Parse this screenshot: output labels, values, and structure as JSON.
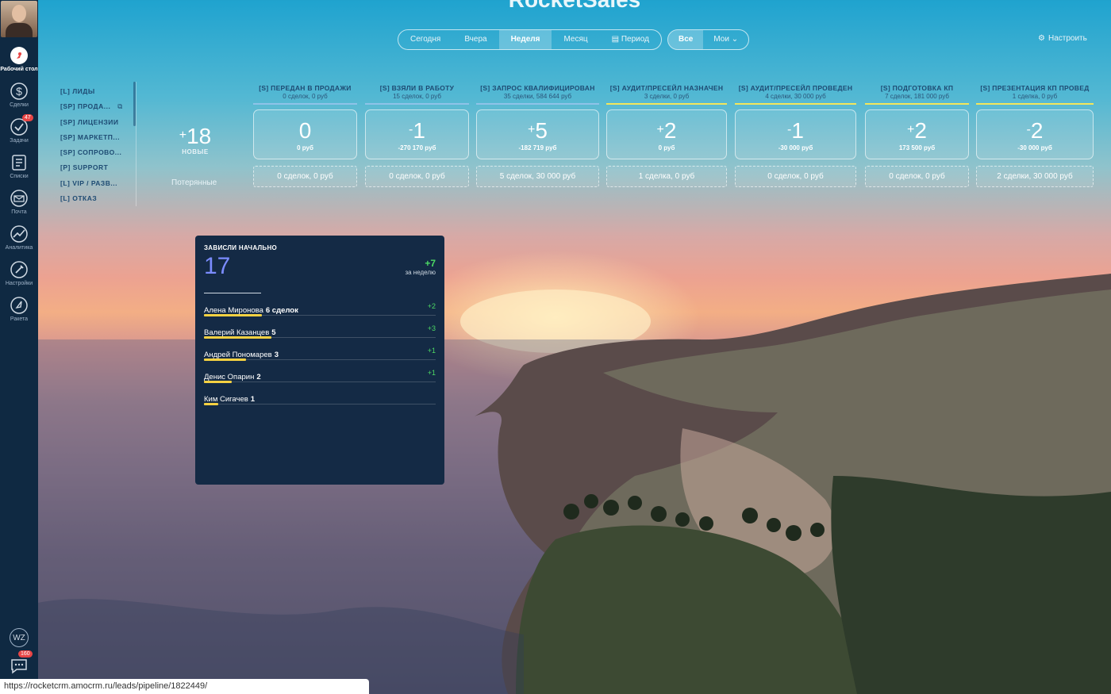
{
  "app": {
    "brand": "RocketSales"
  },
  "sidebar": {
    "items": [
      {
        "label": "Рабочий стол",
        "icon": "rocket-logo-icon",
        "active": true
      },
      {
        "label": "Сделки",
        "icon": "dollar-icon"
      },
      {
        "label": "Задачи",
        "icon": "checkmark-icon",
        "badge": "47"
      },
      {
        "label": "Списки",
        "icon": "list-icon"
      },
      {
        "label": "Почта",
        "icon": "mail-icon"
      },
      {
        "label": "Аналитика",
        "icon": "analytics-icon"
      },
      {
        "label": "Настройки",
        "icon": "settings-icon"
      },
      {
        "label": "Ракета",
        "icon": "rocket-icon"
      }
    ],
    "bottom": {
      "wz_label": "WZ",
      "chat_badge": "160"
    }
  },
  "filters": {
    "period": [
      "Сегодня",
      "Вчера",
      "Неделя",
      "Месяц",
      "Период"
    ],
    "period_active": "Неделя",
    "scope": [
      "Все",
      "Мои"
    ],
    "scope_active": "Все",
    "settings_label": "Настроить"
  },
  "pipelines": [
    "[L] ЛИДЫ",
    "[SP] ПРОДА...",
    "[SP] ЛИЦЕНЗИИ",
    "[SP] МАРКЕТП...",
    "[SP] СОПРОВО...",
    "[P] SUPPORT",
    "[L] VIP / РАЗВ...",
    "[L] ОТКАЗ"
  ],
  "summary": {
    "new_sign": "+",
    "new_count": "18",
    "new_label": "НОВЫЕ",
    "lost_label": "Потерянные"
  },
  "stages": [
    {
      "title": "[S] ПЕРЕДАН В ПРОДАЖИ",
      "sub": "0 сделок, 0 руб",
      "bar": "#8fc3e8",
      "sign": "",
      "delta": "0",
      "sum": "0 руб",
      "lost": "0 сделок, 0 руб"
    },
    {
      "title": "[S] ВЗЯЛИ В РАБОТУ",
      "sub": "15 сделок, 0 руб",
      "bar": "#8fc3e8",
      "sign": "-",
      "delta": "1",
      "sum": "-270 170 руб",
      "lost": "0 сделок, 0 руб"
    },
    {
      "title": "[S] ЗАПРОС КВАЛИФИЦИРОВАН",
      "sub": "35 сделки, 584 644 руб",
      "bar": "#8fc3e8",
      "sign": "+",
      "delta": "5",
      "sum": "-182 719 руб",
      "lost": "5 сделок, 30 000 руб"
    },
    {
      "title": "[S] АУДИТ/ПРЕСЕЙЛ НАЗНАЧЕН",
      "sub": "3 сделки, 0 руб",
      "bar": "#f3e65a",
      "sign": "+",
      "delta": "2",
      "sum": "0 руб",
      "lost": "1 сделка, 0 руб"
    },
    {
      "title": "[S] АУДИТ/ПРЕСЕЙЛ ПРОВЕДЕН",
      "sub": "4 сделки, 30 000 руб",
      "bar": "#f3e65a",
      "sign": "-",
      "delta": "1",
      "sum": "-30 000 руб",
      "lost": "0 сделок, 0 руб"
    },
    {
      "title": "[S] ПОДГОТОВКА КП",
      "sub": "7 сделок, 181 000 руб",
      "bar": "#f3e65a",
      "sign": "+",
      "delta": "2",
      "sum": "173 500 руб",
      "lost": "0 сделок, 0 руб"
    },
    {
      "title": "[S] ПРЕЗЕНТАЦИЯ КП ПРОВЕД",
      "sub": "1 сделка, 0 руб",
      "bar": "#f3e65a",
      "sign": "-",
      "delta": "2",
      "sum": "-30 000 руб",
      "lost": "2 сделки, 30 000 руб"
    }
  ],
  "stuck": {
    "title": "ЗАВИСЛИ НАЧАЛЬНО",
    "total": "17",
    "week_delta": "+7",
    "week_label": "за неделю",
    "people": [
      {
        "name": "Алена Миронова",
        "count": "6 сделок",
        "delta": "+2",
        "share": 0.25
      },
      {
        "name": "Валерий Казанцев",
        "count": "5",
        "delta": "+3",
        "share": 0.29
      },
      {
        "name": "Андрей Пономарев",
        "count": "3",
        "delta": "+1",
        "share": 0.18
      },
      {
        "name": "Денис Опарин",
        "count": "2",
        "delta": "+1",
        "share": 0.12
      },
      {
        "name": "Ким Сигачев",
        "count": "1",
        "delta": "",
        "share": 0.06
      }
    ]
  },
  "status_url": "https://rocketcrm.amocrm.ru/leads/pipeline/1822449/"
}
